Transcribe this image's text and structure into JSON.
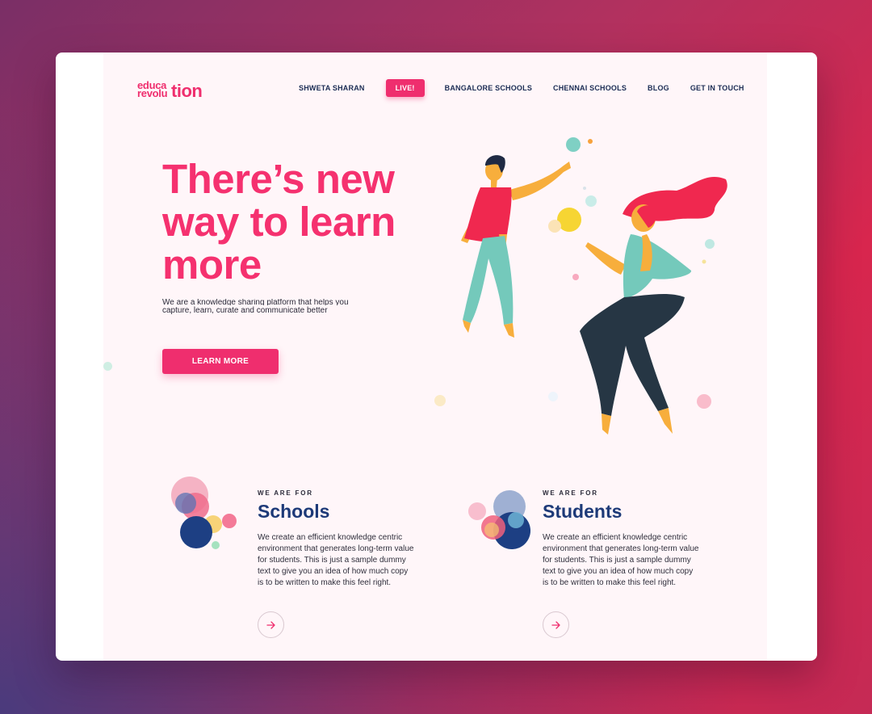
{
  "logo": {
    "line1": "educa",
    "line2": "revolu",
    "tail": "tion"
  },
  "nav": {
    "items": [
      "SHWETA SHARAN",
      "BANGALORE SCHOOLS",
      "CHENNAI SCHOOLS",
      "BLOG",
      "GET IN TOUCH"
    ],
    "live_label": "LIVE!"
  },
  "hero": {
    "title": "There’s new way to learn more",
    "subtitle_line1": "We are a knowledge sharing platform that helps you",
    "subtitle_line2": "capture, learn, curate and communicate better",
    "cta_label": "LEARN MORE"
  },
  "features": [
    {
      "eyebrow": "WE ARE FOR",
      "heading": "Schools",
      "body": "We create an efficient knowledge centric environment that generates long-term value for students. This is just a sample dummy text to give you an idea of how much copy is to be written to make this feel right.",
      "arrow_icon": "arrow-right-icon"
    },
    {
      "eyebrow": "WE ARE FOR",
      "heading": "Students",
      "body": "We create an efficient knowledge centric environment that generates long-term value for students. This is just a sample dummy text to give you an idea of how much copy is to be written to make this feel right.",
      "arrow_icon": "arrow-right-icon"
    }
  ],
  "colors": {
    "brand_pink": "#ef2e6e",
    "navy": "#1d3a78",
    "page_bg": "#fff6f9",
    "teal": "#6fcabb",
    "yellow": "#f6d84a"
  }
}
